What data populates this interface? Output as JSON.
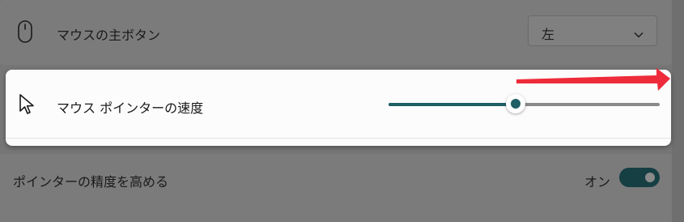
{
  "primary_button": {
    "label": "マウスの主ボタン",
    "icon": "mouse-icon",
    "dropdown_value": "左"
  },
  "pointer_speed": {
    "label": "マウス ポインターの速度",
    "icon": "pointer-cursor-icon",
    "slider_value_fraction": 0.47,
    "accent_color": "#1f5f66"
  },
  "pointer_precision": {
    "label": "ポインターの精度を高める",
    "toggle_state_label": "オン",
    "toggle_on": true
  },
  "annotation": {
    "icon": "red-arrow-right",
    "color": "#ee2b3a"
  }
}
